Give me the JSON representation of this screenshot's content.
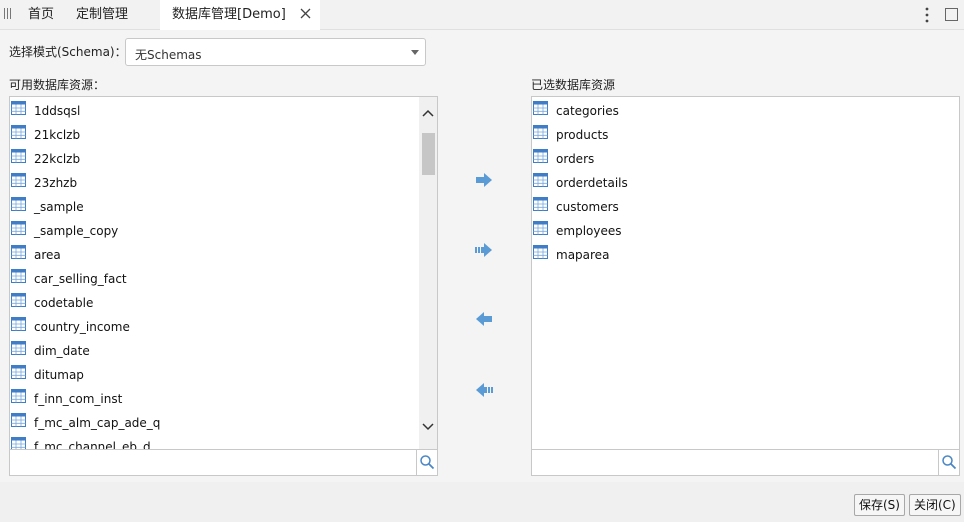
{
  "tabs": [
    {
      "label": "首页"
    },
    {
      "label": "定制管理"
    },
    {
      "label": "数据库管理[Demo]"
    }
  ],
  "schema": {
    "label": "选择模式(Schema)：",
    "value": "无Schemas"
  },
  "available": {
    "title": "可用数据库资源：",
    "items": [
      "1ddsqsl",
      "21kclzb",
      "22kclzb",
      "23zhzb",
      "_sample",
      "_sample_copy",
      "area",
      "car_selling_fact",
      "codetable",
      "country_income",
      "dim_date",
      "ditumap",
      "f_inn_com_inst",
      "f_mc_alm_cap_ade_q",
      "f_mc_channel_eb_d"
    ],
    "search_value": ""
  },
  "selected": {
    "title": "已选数据库资源",
    "items": [
      "categories",
      "products",
      "orders",
      "orderdetails",
      "customers",
      "employees",
      "maparea"
    ],
    "search_value": ""
  },
  "actions": {
    "add": "arrow-right-icon",
    "add_all": "double-arrow-right-icon",
    "remove": "arrow-left-icon",
    "remove_all": "double-arrow-left-icon"
  },
  "footer": {
    "save": "保存(S)",
    "close": "关闭(C)"
  },
  "colors": {
    "accent": "#5b9bd5",
    "icon_blue": "#3f7ec6"
  }
}
